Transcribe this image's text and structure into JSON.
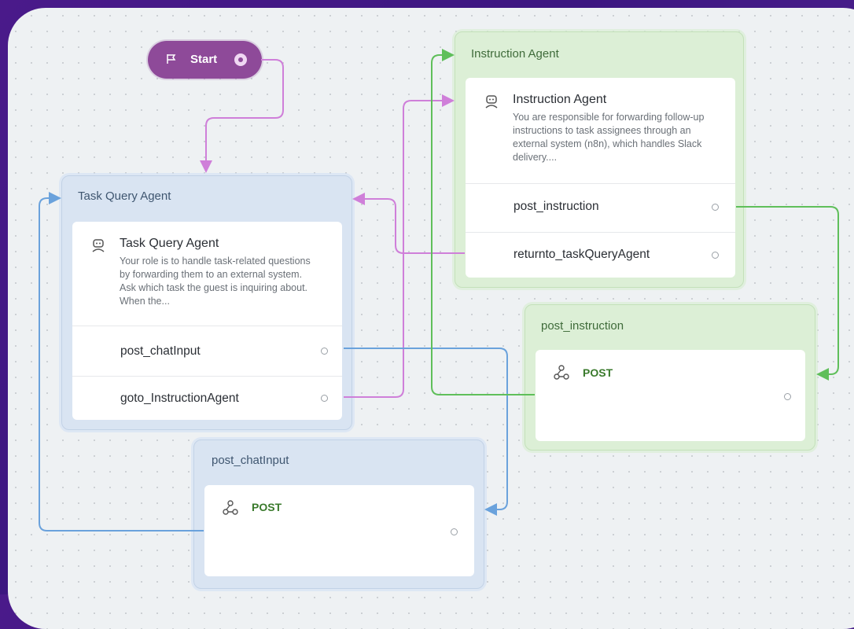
{
  "start": {
    "label": "Start"
  },
  "task_query_agent": {
    "header": "Task Query Agent",
    "title": "Task Query Agent",
    "description": "Your role is to handle task-related questions by forwarding them to an external system. Ask which task the guest is inquiring about. When the...",
    "routes": [
      "post_chatInput",
      "goto_InstructionAgent"
    ]
  },
  "instruction_agent": {
    "header": "Instruction Agent",
    "title": "Instruction Agent",
    "description": "You are responsible for forwarding follow-up instructions to task assignees through an external system (n8n), which handles Slack delivery....",
    "routes": [
      "post_instruction",
      "returnto_taskQueryAgent"
    ]
  },
  "post_instruction": {
    "header": "post_instruction",
    "method": "POST"
  },
  "post_chat_input": {
    "header": "post_chatInput",
    "method": "POST"
  },
  "colors": {
    "start": "#8e4a99",
    "edge_purple": "#cf7fd9",
    "edge_blue": "#6aa2dc",
    "edge_green": "#5fbf5a",
    "post_text": "#3a7a2c"
  },
  "icons": {
    "start": "flag-icon",
    "agent": "robot-icon",
    "webhook": "webhook-icon"
  }
}
